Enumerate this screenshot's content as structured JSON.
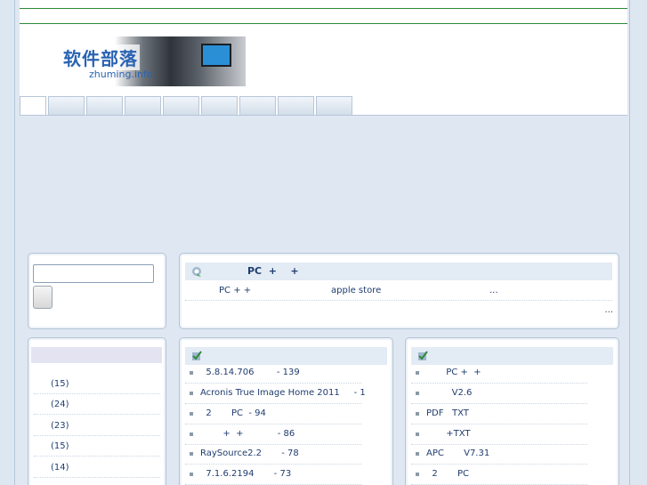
{
  "header": {
    "logo_title": "软件部落",
    "logo_subtitle": "zhuming.info"
  },
  "nav": {
    "tab_count": 9
  },
  "search": {
    "input_value": "",
    "button_label": ""
  },
  "notice": {
    "title": "PC  +    +",
    "line_part1": "PC + +",
    "line_part2": "apple store",
    "line_part3": "...",
    "more": "..."
  },
  "categories": {
    "items": [
      {
        "label": "(15)"
      },
      {
        "label": "(24)"
      },
      {
        "label": "(23)"
      },
      {
        "label": "(15)"
      },
      {
        "label": "(14)"
      }
    ]
  },
  "popular": {
    "items": [
      {
        "label": "  5.8.14.706        - 139"
      },
      {
        "label": "Acronis True Image Home 2011     - 1"
      },
      {
        "label": "  2       PC  - 94"
      },
      {
        "label": "        +  +            - 86"
      },
      {
        "label": "RaySource2.2       - 78"
      },
      {
        "label": "  7.1.6.2194       - 73"
      }
    ]
  },
  "latest": {
    "items": [
      {
        "label": "       PC +  +"
      },
      {
        "label": "         V2.6"
      },
      {
        "label": "PDF   TXT"
      },
      {
        "label": "       +TXT"
      },
      {
        "label": "APC       V7.31"
      },
      {
        "label": "  2       PC"
      }
    ]
  },
  "colors": {
    "accent_green": "#2e8a3b",
    "text_blue": "#1f3d6e",
    "panel_bg": "#dfe8f2"
  }
}
